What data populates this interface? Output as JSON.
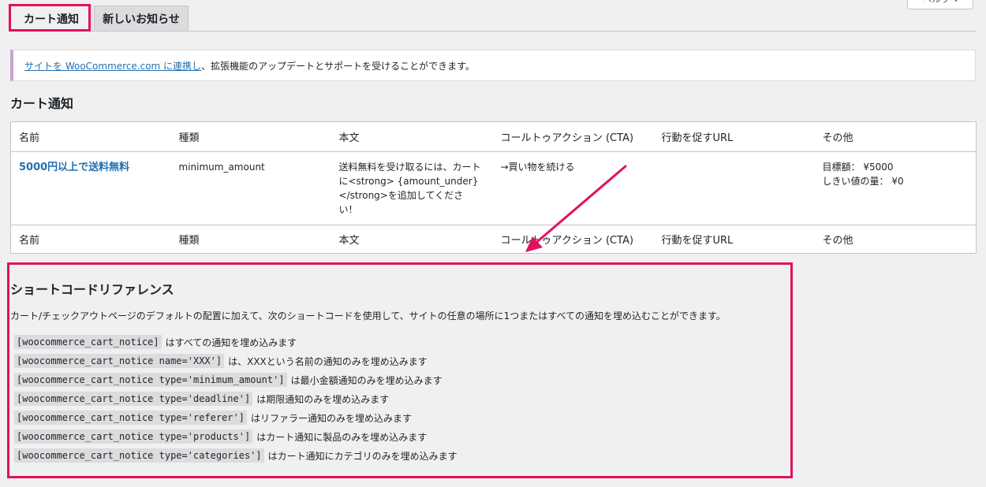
{
  "help_tab": "ヘルプ ▾",
  "tabs": [
    {
      "label": "カート通知"
    },
    {
      "label": "新しいお知らせ"
    }
  ],
  "notice": {
    "link": "サイトを WooCommerce.com に連携し",
    "rest": "、拡張機能のアップデートとサポートを受けることができます。"
  },
  "section_title": "カート通知",
  "table": {
    "headers": [
      "名前",
      "種類",
      "本文",
      "コールトゥアクション (CTA)",
      "行動を促すURL",
      "その他"
    ],
    "row": {
      "name": "5000円以上で送料無料",
      "type": "minimum_amount",
      "body": "送料無料を受け取るには、カートに<strong> {amount_under}</strong>を追加してください！",
      "cta": "→買い物を続ける",
      "url": "",
      "other_line1": "目標額： ¥5000",
      "other_line2": "しきい値の量： ¥0"
    }
  },
  "shortcode_ref": {
    "title": "ショートコードリファレンス",
    "description": "カート/チェックアウトページのデフォルトの配置に加えて、次のショートコードを使用して、サイトの任意の場所に1つまたはすべての通知を埋め込むことができます。",
    "items": [
      {
        "code": "[woocommerce_cart_notice]",
        "desc": "はすべての通知を埋め込みます"
      },
      {
        "code": "[woocommerce_cart_notice name='XXX']",
        "desc": "は、XXXという名前の通知のみを埋め込みます"
      },
      {
        "code": "[woocommerce_cart_notice type='minimum_amount']",
        "desc": "は最小金額通知のみを埋め込みます"
      },
      {
        "code": "[woocommerce_cart_notice type='deadline']",
        "desc": "は期限通知のみを埋め込みます"
      },
      {
        "code": "[woocommerce_cart_notice type='referer']",
        "desc": "はリファラー通知のみを埋め込みます"
      },
      {
        "code": "[woocommerce_cart_notice type='products']",
        "desc": "はカート通知に製品のみを埋め込みます"
      },
      {
        "code": "[woocommerce_cart_notice type='categories']",
        "desc": "はカート通知にカテゴリのみを埋め込みます"
      }
    ]
  },
  "colors": {
    "highlight": "#e0115f",
    "link": "#2271b1",
    "notice_border": "#c9a4d3"
  }
}
